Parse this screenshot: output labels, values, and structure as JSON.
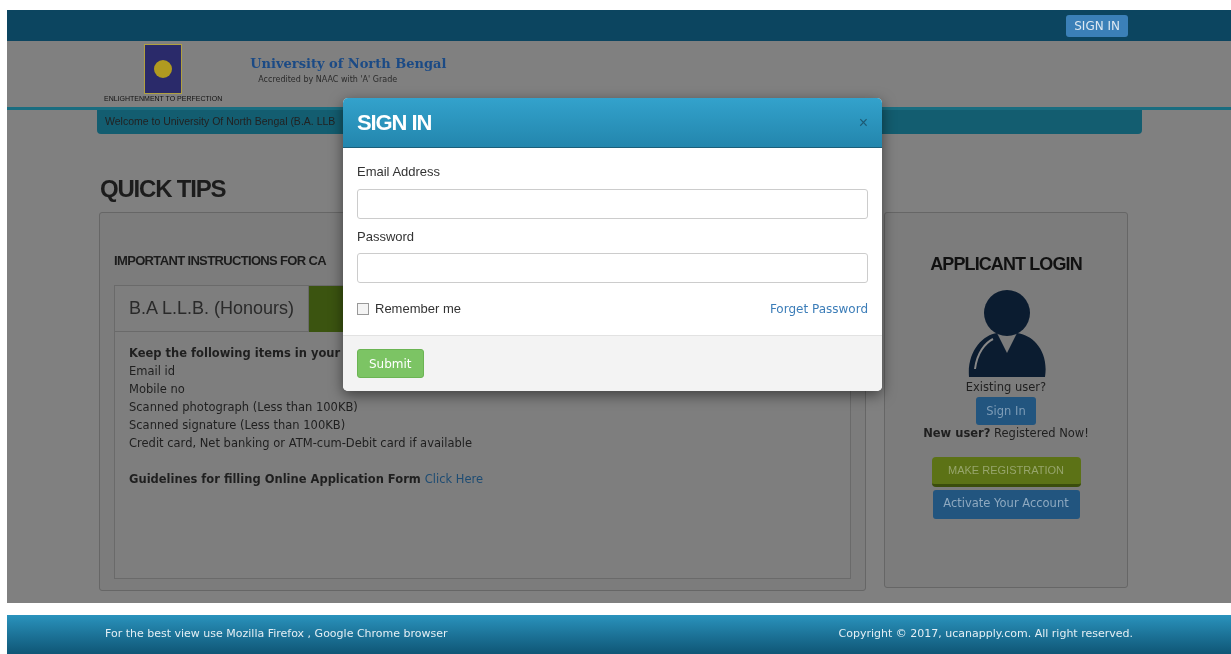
{
  "top_bar": {
    "sign_in_button": "SIGN IN"
  },
  "header": {
    "title": "University of North Bengal",
    "subtitle": "Accredited by NAAC with 'A' Grade",
    "logo_motto": "ENLIGHTENMENT TO PERFECTION"
  },
  "welcome_bar": {
    "text": "Welcome to University Of North Bengal (B.A. LLB"
  },
  "page_title": "QUICK TIPS",
  "instructions": {
    "heading": "IMPORTANT INSTRUCTIONS FOR CA",
    "tab": "B.A L.L.B. (Honours)",
    "intro": "Keep the following items in your",
    "items": [
      "Email id",
      "Mobile no",
      "Scanned photograph (Less than 100KB)",
      "Scanned signature (Less than 100KB)",
      "Credit card, Net banking or ATM-cum-Debit card if available"
    ],
    "guideline": "Guidelines for filling Online Application Form",
    "guideline_link": "Click Here"
  },
  "applicant_login": {
    "heading": "APPLICANT LOGIN",
    "existing": "Existing user?",
    "sign_in_button": "Sign In",
    "new_user": "**New user?** Registered Now!",
    "register_button": "MAKE REGISTRATION",
    "activate_button": "Activate Your Account"
  },
  "dialog": {
    "title": "SIGN IN",
    "close": "×",
    "fields": [
      {
        "label": "Email Address"
      },
      {
        "label": "Password"
      }
    ],
    "remember_me": {
      "label": "Remember me",
      "checked": false
    },
    "forgot_link": "Forget Password",
    "submit": "Submit"
  },
  "footer": {
    "left": "For the best view use Mozilla Firefox , Google Chrome browser",
    "right": "Copyright © 2017, ucanapply.com. All right reserved."
  }
}
